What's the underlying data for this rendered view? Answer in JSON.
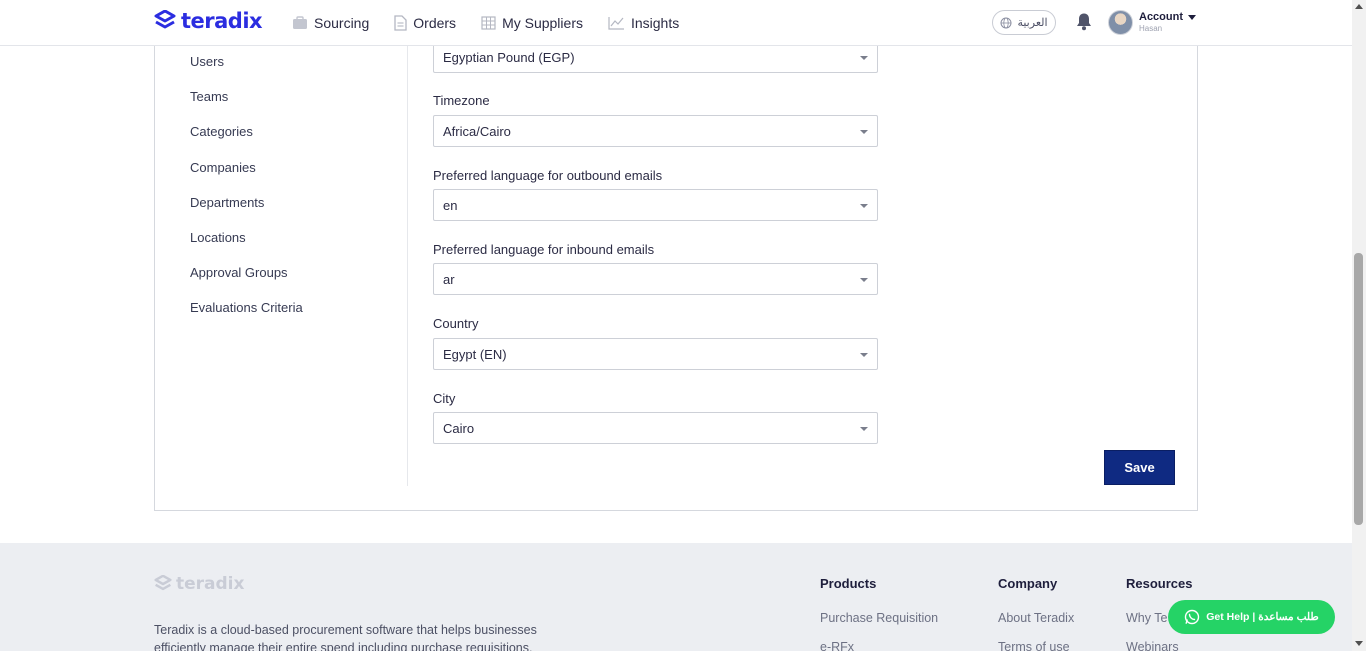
{
  "brand": {
    "name": "teradix",
    "color": "#2b2de0"
  },
  "nav": [
    {
      "label": "Sourcing",
      "icon": "briefcase-icon"
    },
    {
      "label": "Orders",
      "icon": "document-icon"
    },
    {
      "label": "My Suppliers",
      "icon": "building-icon"
    },
    {
      "label": "Insights",
      "icon": "chart-icon"
    }
  ],
  "header": {
    "language_toggle": "العربية",
    "account_label": "Account",
    "account_user": "Hasan"
  },
  "sidebar": {
    "items": [
      "Users",
      "Teams",
      "Categories",
      "Companies",
      "Departments",
      "Locations",
      "Approval Groups",
      "Evaluations Criteria"
    ]
  },
  "form": {
    "currency_value": "Egyptian Pound (EGP)",
    "timezone_label": "Timezone",
    "timezone_value": "Africa/Cairo",
    "outbound_label": "Preferred language for outbound emails",
    "outbound_value": "en",
    "inbound_label": "Preferred language for inbound emails",
    "inbound_value": "ar",
    "country_label": "Country",
    "country_value": "Egypt (EN)",
    "city_label": "City",
    "city_value": "Cairo",
    "save_label": "Save",
    "save_color": "#0f2a82"
  },
  "footer": {
    "brand": "teradix",
    "description": "Teradix is a cloud-based procurement software that helps businesses efficiently manage their entire spend including purchase requisitions,",
    "products_head": "Products",
    "products_links": [
      "Purchase Requisition",
      "e-RFx"
    ],
    "company_head": "Company",
    "company_links": [
      "About Teradix",
      "Terms of use"
    ],
    "resources_head": "Resources",
    "resources_links": [
      "Why Te",
      "Webinars"
    ]
  },
  "help": {
    "label": "Get Help | طلب مساعدة",
    "color": "#25d366"
  }
}
